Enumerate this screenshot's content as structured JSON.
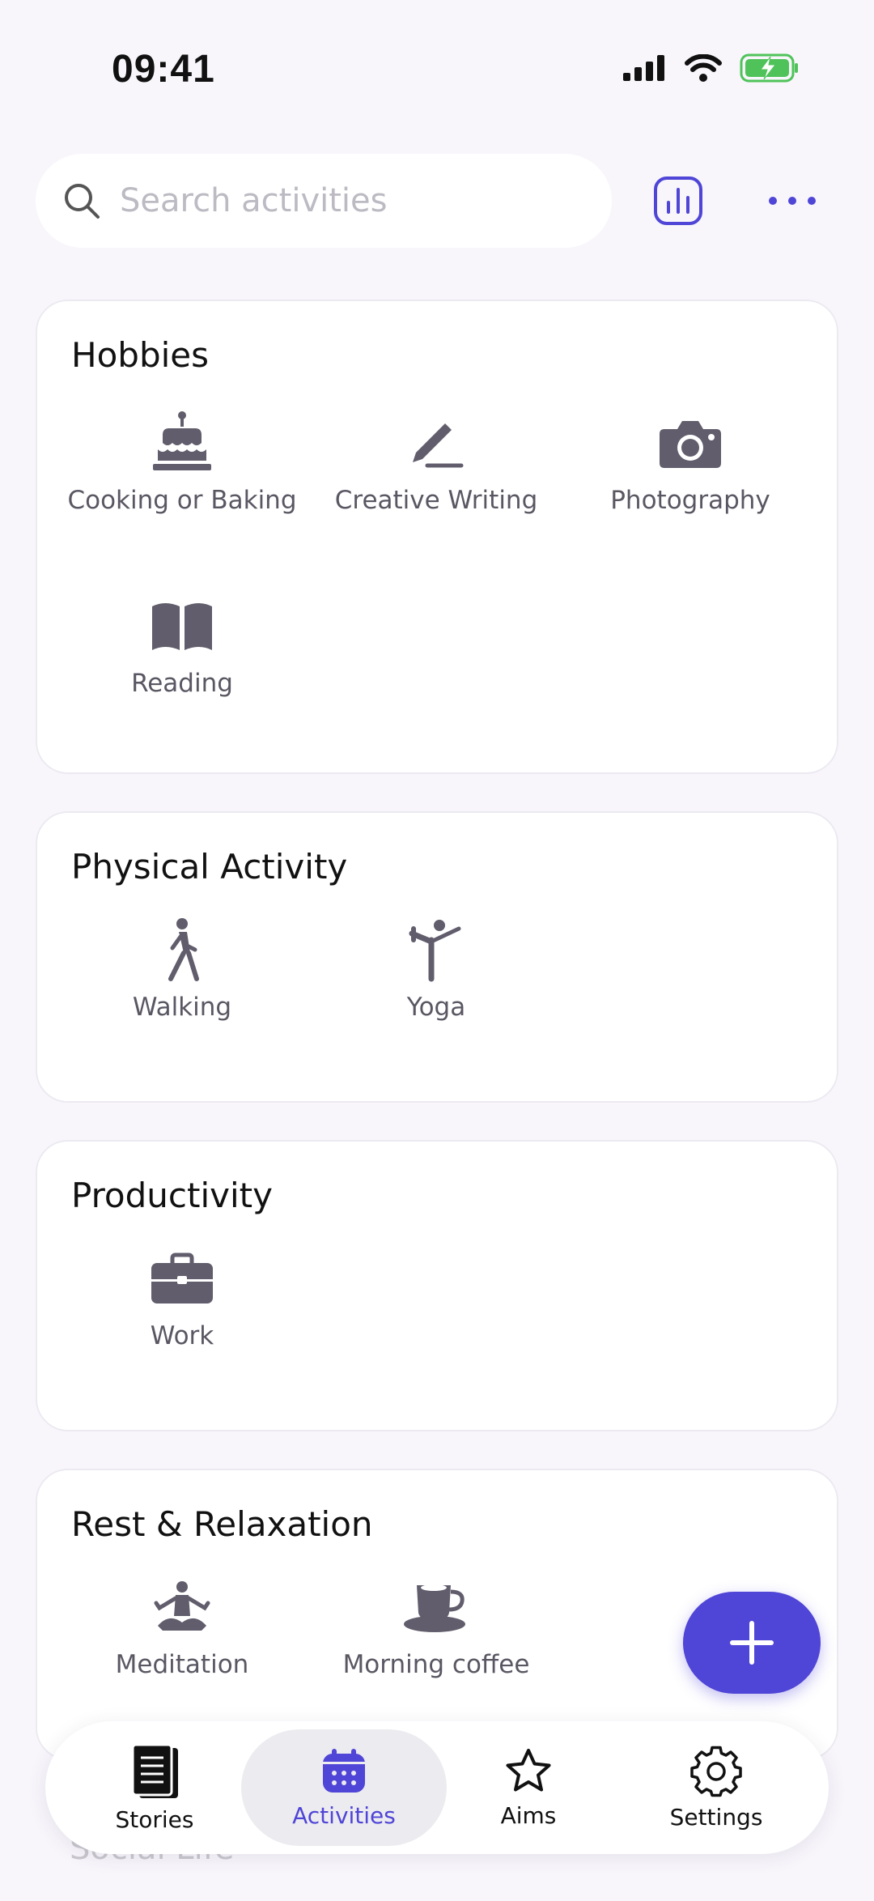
{
  "status_bar": {
    "time": "09:41"
  },
  "search": {
    "placeholder": "Search activities",
    "value": ""
  },
  "categories": [
    {
      "title": "Hobbies",
      "items": [
        {
          "label": "Cooking or Baking",
          "icon": "cake-icon"
        },
        {
          "label": "Creative Writing",
          "icon": "pencil-icon"
        },
        {
          "label": "Photography",
          "icon": "camera-icon"
        },
        {
          "label": "Reading",
          "icon": "book-icon"
        }
      ]
    },
    {
      "title": "Physical Activity",
      "items": [
        {
          "label": "Walking",
          "icon": "walking-icon"
        },
        {
          "label": "Yoga",
          "icon": "yoga-icon"
        }
      ]
    },
    {
      "title": "Productivity",
      "items": [
        {
          "label": "Work",
          "icon": "briefcase-icon"
        }
      ]
    },
    {
      "title": "Rest & Relaxation",
      "items": [
        {
          "label": "Meditation",
          "icon": "meditation-icon"
        },
        {
          "label": "Morning coffee",
          "icon": "coffee-cup-icon"
        }
      ]
    },
    {
      "title": "Social Life",
      "items": []
    }
  ],
  "bottom_nav": {
    "items": [
      {
        "label": "Stories",
        "icon": "notebook-icon"
      },
      {
        "label": "Activities",
        "icon": "calendar-icon",
        "active": true
      },
      {
        "label": "Aims",
        "icon": "star-icon"
      },
      {
        "label": "Settings",
        "icon": "gear-icon"
      }
    ]
  },
  "colors": {
    "accent": "#4f45d6",
    "icon": "#615d6c",
    "background": "#f8f6fb",
    "card": "#ffffff"
  }
}
